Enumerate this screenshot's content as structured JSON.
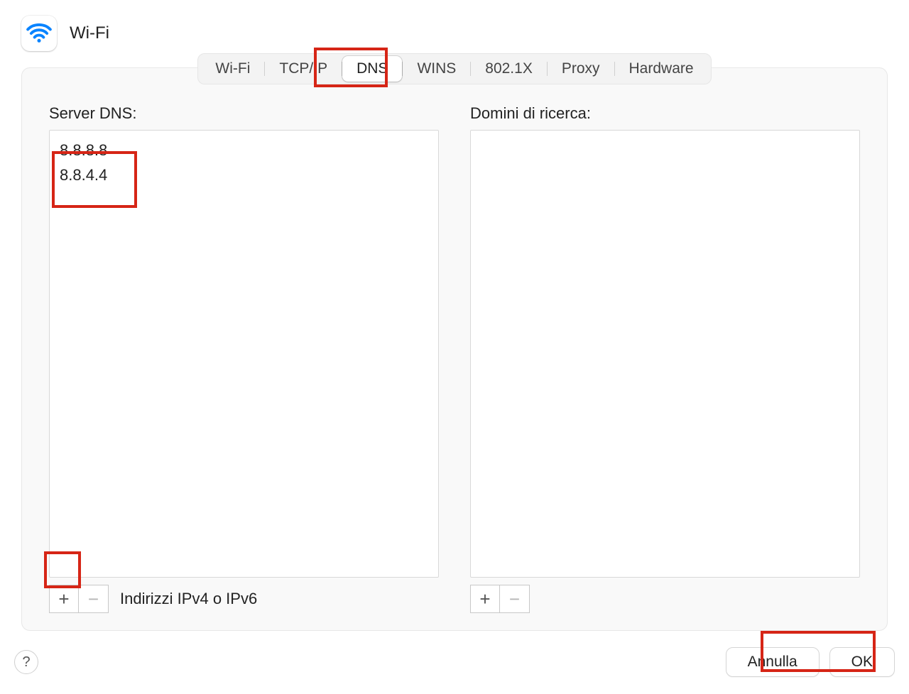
{
  "header": {
    "title": "Wi-Fi"
  },
  "tabs": [
    {
      "key": "wifi",
      "label": "Wi-Fi"
    },
    {
      "key": "tcpip",
      "label": "TCP/IP"
    },
    {
      "key": "dns",
      "label": "DNS"
    },
    {
      "key": "wins",
      "label": "WINS"
    },
    {
      "key": "8021x",
      "label": "802.1X"
    },
    {
      "key": "proxy",
      "label": "Proxy"
    },
    {
      "key": "hardware",
      "label": "Hardware"
    }
  ],
  "active_tab": "dns",
  "dns": {
    "servers_label": "Server DNS:",
    "servers": [
      "8.8.8.8",
      "8.8.4.4"
    ],
    "servers_add_hint": "Indirizzi IPv4 o IPv6",
    "domains_label": "Domini di ricerca:",
    "domains": []
  },
  "icons": {
    "plus": "+",
    "minus": "−",
    "help": "?"
  },
  "footer": {
    "cancel": "Annulla",
    "ok": "OK"
  }
}
